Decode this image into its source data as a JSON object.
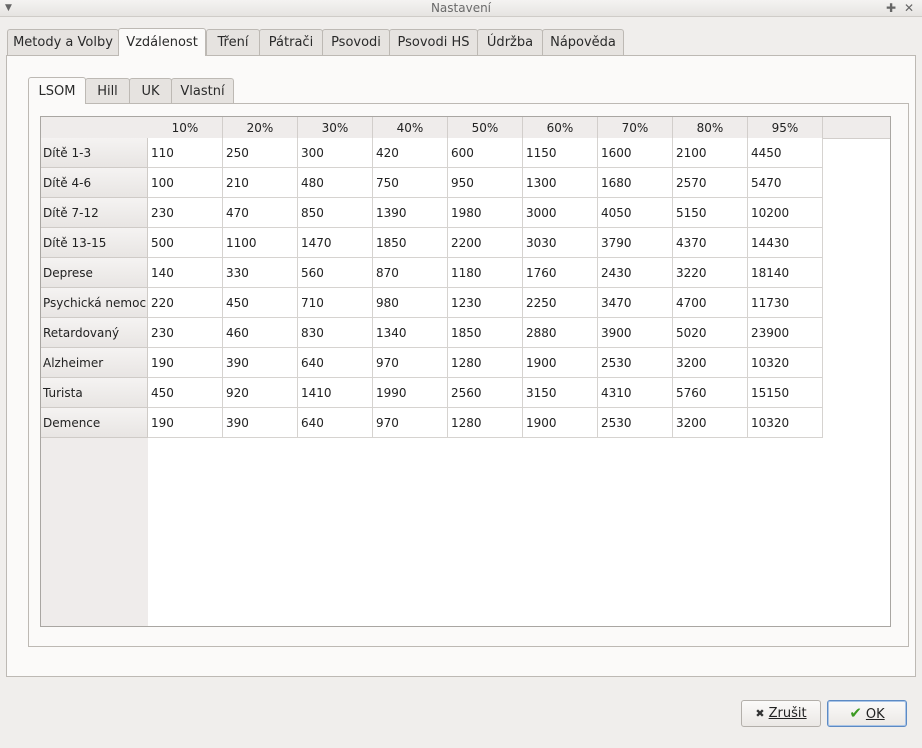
{
  "window": {
    "title": "Nastavení"
  },
  "tabs": [
    {
      "label": "Metody a Volby"
    },
    {
      "label": "Vzdálenost"
    },
    {
      "label": "Tření"
    },
    {
      "label": "Pátrači"
    },
    {
      "label": "Psovodi"
    },
    {
      "label": "Psovodi HS"
    },
    {
      "label": "Údržba"
    },
    {
      "label": "Nápověda"
    }
  ],
  "active_tab": "Vzdálenost",
  "subtabs": [
    {
      "label": "LSOM"
    },
    {
      "label": "Hill"
    },
    {
      "label": "UK"
    },
    {
      "label": "Vlastní"
    }
  ],
  "active_subtab": "LSOM",
  "table": {
    "columns": [
      "10%",
      "20%",
      "30%",
      "40%",
      "50%",
      "60%",
      "70%",
      "80%",
      "95%"
    ],
    "rows": [
      {
        "label": "Dítě 1-3",
        "values": [
          "110",
          "250",
          "300",
          "420",
          "600",
          "1150",
          "1600",
          "2100",
          "4450"
        ]
      },
      {
        "label": "Dítě 4-6",
        "values": [
          "100",
          "210",
          "480",
          "750",
          "950",
          "1300",
          "1680",
          "2570",
          "5470"
        ]
      },
      {
        "label": "Dítě 7-12",
        "values": [
          "230",
          "470",
          "850",
          "1390",
          "1980",
          "3000",
          "4050",
          "5150",
          "10200"
        ]
      },
      {
        "label": "Dítě 13-15",
        "values": [
          "500",
          "1100",
          "1470",
          "1850",
          "2200",
          "3030",
          "3790",
          "4370",
          "14430"
        ]
      },
      {
        "label": "Deprese",
        "values": [
          "140",
          "330",
          "560",
          "870",
          "1180",
          "1760",
          "2430",
          "3220",
          "18140"
        ]
      },
      {
        "label": "Psychická nemoc",
        "values": [
          "220",
          "450",
          "710",
          "980",
          "1230",
          "2250",
          "3470",
          "4700",
          "11730"
        ]
      },
      {
        "label": "Retardovaný",
        "values": [
          "230",
          "460",
          "830",
          "1340",
          "1850",
          "2880",
          "3900",
          "5020",
          "23900"
        ]
      },
      {
        "label": "Alzheimer",
        "values": [
          "190",
          "390",
          "640",
          "970",
          "1280",
          "1900",
          "2530",
          "3200",
          "10320"
        ]
      },
      {
        "label": "Turista",
        "values": [
          "450",
          "920",
          "1410",
          "1990",
          "2560",
          "3150",
          "4310",
          "5760",
          "15150"
        ]
      },
      {
        "label": "Demence",
        "values": [
          "190",
          "390",
          "640",
          "970",
          "1280",
          "1900",
          "2530",
          "3200",
          "10320"
        ]
      }
    ]
  },
  "buttons": {
    "cancel": {
      "label": "Zrušit",
      "icon": "x-icon"
    },
    "ok": {
      "label": "OK",
      "icon": "check-icon"
    }
  }
}
